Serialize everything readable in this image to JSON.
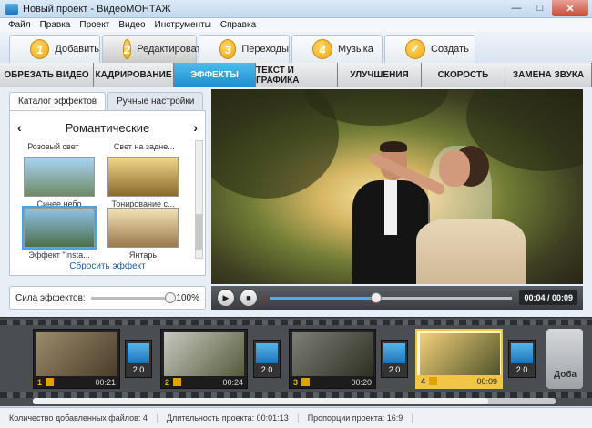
{
  "window": {
    "title": "Новый проект - ВидеоМОНТАЖ"
  },
  "menu": [
    "Файл",
    "Правка",
    "Проект",
    "Видео",
    "Инструменты",
    "Справка"
  ],
  "steps": [
    {
      "num": "1",
      "label": "Добавить"
    },
    {
      "num": "2",
      "label": "Редактировать"
    },
    {
      "num": "3",
      "label": "Переходы"
    },
    {
      "num": "4",
      "label": "Музыка"
    },
    {
      "num": "✓",
      "label": "Создать"
    }
  ],
  "edit_tabs": [
    "ОБРЕЗАТЬ ВИДЕО",
    "КАДРИРОВАНИЕ",
    "ЭФФЕКТЫ",
    "ТЕКСТ И ГРАФИКА",
    "УЛУЧШЕНИЯ",
    "СКОРОСТЬ",
    "ЗАМЕНА ЗВУКА"
  ],
  "left": {
    "tabs": [
      "Каталог эффектов",
      "Ручные настройки"
    ],
    "category": "Романтические",
    "prev": "‹",
    "next": "›",
    "top_labels": [
      "Розовый свет",
      "Свет на задне..."
    ],
    "effects": [
      "Синее небо",
      "Тонирование с...",
      "Эффект \"Insta...",
      "Янтарь"
    ],
    "reset": "Сбросить эффект"
  },
  "strength": {
    "label": "Сила эффектов:",
    "value_text": "100%",
    "value": 1.0
  },
  "player": {
    "time": "00:04 / 00:09",
    "progress": 0.44
  },
  "clips": [
    {
      "num": "1",
      "dur": "00:21"
    },
    {
      "num": "2",
      "dur": "00:24"
    },
    {
      "num": "3",
      "dur": "00:20"
    },
    {
      "num": "4",
      "dur": "00:09"
    }
  ],
  "transitions": [
    "2.0",
    "2.0",
    "2.0",
    "2.0"
  ],
  "add_slot": "Доба",
  "status": {
    "files": "Количество добавленных файлов: 4",
    "duration": "Длительность проекта:  00:01:13",
    "ratio": "Пропорции проекта:  16:9"
  },
  "colors": {
    "accent": "#2aa0dd",
    "selected_clip": "#f1c644",
    "step_badge": "#f0a30b"
  }
}
